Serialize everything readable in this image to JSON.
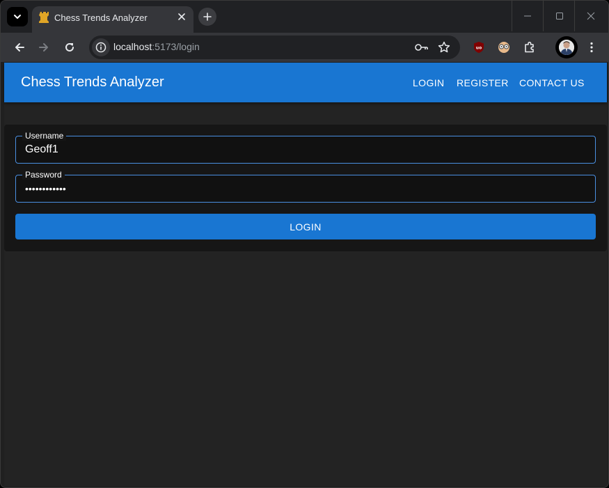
{
  "browser": {
    "tab": {
      "title": "Chess Trends Analyzer",
      "favicon": "chess-rook-icon"
    },
    "address": {
      "host": "localhost",
      "path": ":5173/login"
    },
    "colors": {
      "tabstrip": "#202124",
      "toolbar": "#35363a"
    }
  },
  "app": {
    "title": "Chess Trends Analyzer",
    "nav": {
      "login": "LOGIN",
      "register": "REGISTER",
      "contact": "CONTACT US"
    },
    "colors": {
      "primary": "#1976d2",
      "background": "#232323",
      "card": "#161616",
      "field_border": "#4a90e2"
    }
  },
  "form": {
    "username": {
      "label": "Username",
      "value": "Geoff1"
    },
    "password": {
      "label": "Password",
      "value": "••••••••••••"
    },
    "submit_label": "LOGIN"
  }
}
